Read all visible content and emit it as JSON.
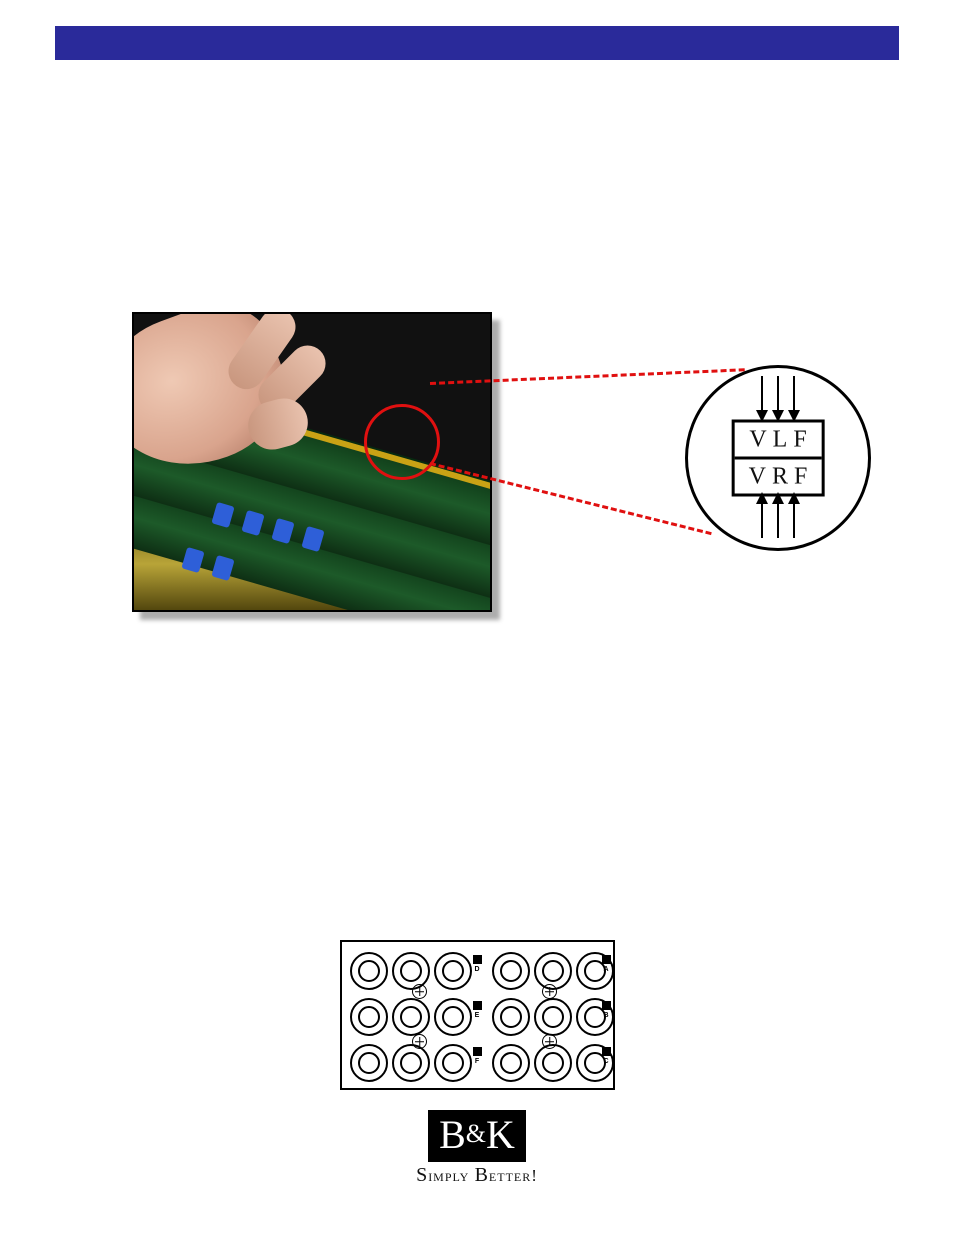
{
  "header": {
    "title": ""
  },
  "diagram": {
    "top_label": "VLF",
    "bottom_label": "VRF"
  },
  "rear_panel": {
    "row_labels_right": [
      "A",
      "B",
      "C"
    ],
    "row_labels_mid": [
      "D",
      "E",
      "F"
    ]
  },
  "logo": {
    "brand_left": "B",
    "brand_amp": "&",
    "brand_right": "K",
    "tagline": "Simply Better!"
  }
}
